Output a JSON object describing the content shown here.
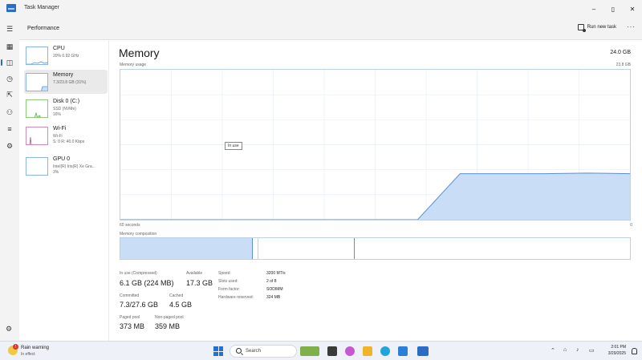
{
  "window": {
    "title": "Task Manager",
    "controls": {
      "minimize": "–",
      "maximize": "▯",
      "close": "✕"
    }
  },
  "header": {
    "title": "Performance",
    "run_new_task": "Run new task",
    "more": "···"
  },
  "nav": {
    "icons": [
      "hamburger-icon",
      "processes-icon",
      "performance-icon",
      "app-history-icon",
      "startup-apps-icon",
      "users-icon",
      "details-icon",
      "services-icon",
      "settings-icon"
    ]
  },
  "sidebar": {
    "items": [
      {
        "name": "CPU",
        "sub": "20% 0.92 GHz",
        "sub2": ""
      },
      {
        "name": "Memory",
        "sub": "7.3/23.8 GB (31%)",
        "sub2": ""
      },
      {
        "name": "Disk 0 (C:)",
        "sub": "SSD (NVMe)",
        "sub2": "16%"
      },
      {
        "name": "Wi-Fi",
        "sub": "Wi-Fi",
        "sub2": "S: 0 R: 40.0 Kbps"
      },
      {
        "name": "GPU 0",
        "sub": "Intel(R) Iris(R) Xe Gra...",
        "sub2": "3%"
      }
    ]
  },
  "main": {
    "title": "Memory",
    "total": "24.0 GB",
    "usage_label": "Memory usage",
    "usage_max": "23.8 GB",
    "tooltip": "In use",
    "axis_left": "60 seconds",
    "axis_right": "0",
    "composition_label": "Memory composition"
  },
  "stats": {
    "in_use_label": "In use (Compressed)",
    "in_use_value": "6.1 GB (224 MB)",
    "available_label": "Available",
    "available_value": "17.3 GB",
    "committed_label": "Committed",
    "committed_value": "7.3/27.6 GB",
    "cached_label": "Cached",
    "cached_value": "4.5 GB",
    "paged_label": "Paged pool",
    "paged_value": "373 MB",
    "nonpaged_label": "Non-paged pool",
    "nonpaged_value": "359 MB"
  },
  "specs": [
    {
      "label": "Speed:",
      "value": "3200 MT/s"
    },
    {
      "label": "Slots used:",
      "value": "2 of 8"
    },
    {
      "label": "Form factor:",
      "value": "SODIMM"
    },
    {
      "label": "Hardware reserved:",
      "value": "324 MB"
    }
  ],
  "chart_data": {
    "type": "area",
    "x": [
      60,
      50,
      40,
      30,
      25,
      20,
      15,
      10,
      5,
      0
    ],
    "values": [
      0,
      0,
      0,
      0,
      0,
      7.3,
      7.3,
      7.3,
      7.4,
      7.3
    ],
    "title": "",
    "xlabel": "60 seconds",
    "ylabel": "Memory usage",
    "ylim": [
      0,
      23.8
    ],
    "grid": true,
    "color": "#c9ddf7",
    "line_color": "#5b8fd8"
  },
  "composition": {
    "in_use_fraction": 0.26,
    "modified_fraction": 0.01,
    "standby_fraction": 0.19,
    "in_use_color": "#c9ddf7",
    "line_color": "#5b8fd8"
  },
  "taskbar": {
    "weather_title": "Rain warning",
    "weather_sub": "In effect",
    "weather_badge": "!",
    "search_placeholder": "Search",
    "time": "2:01 PM",
    "date": "3/29/2025"
  }
}
